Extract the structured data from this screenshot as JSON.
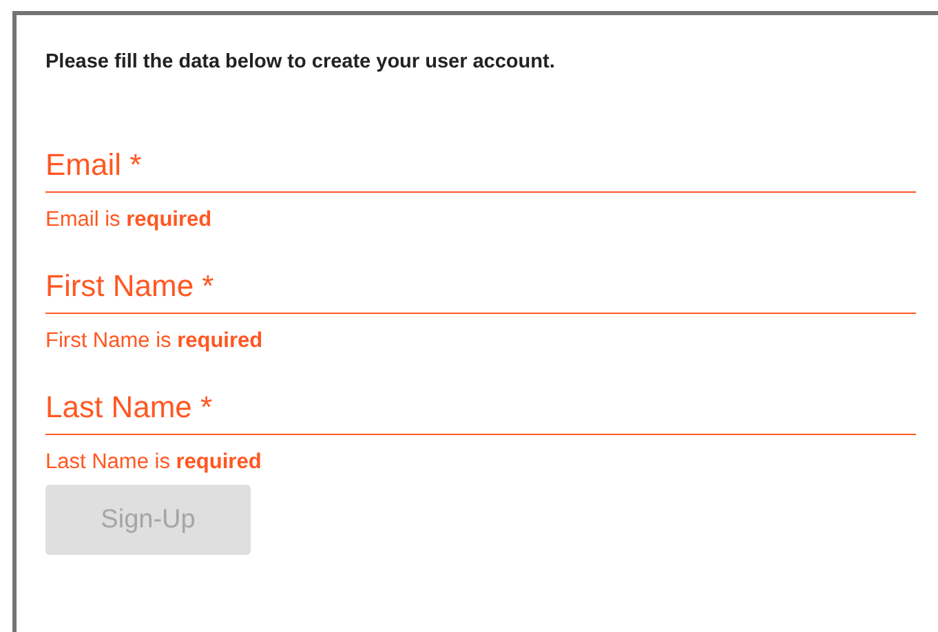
{
  "intro": "Please fill the data below to create your user account.",
  "fields": [
    {
      "placeholder": "Email *",
      "invalid": true,
      "error": "Email is **required**"
    },
    {
      "placeholder": "First Name *",
      "invalid": true,
      "error": "First Name is **required**"
    },
    {
      "placeholder": "Last Name *",
      "invalid": true,
      "error": "Last Name is **required**"
    }
  ],
  "submit": {
    "label": "Sign-Up",
    "disabled": true
  }
}
